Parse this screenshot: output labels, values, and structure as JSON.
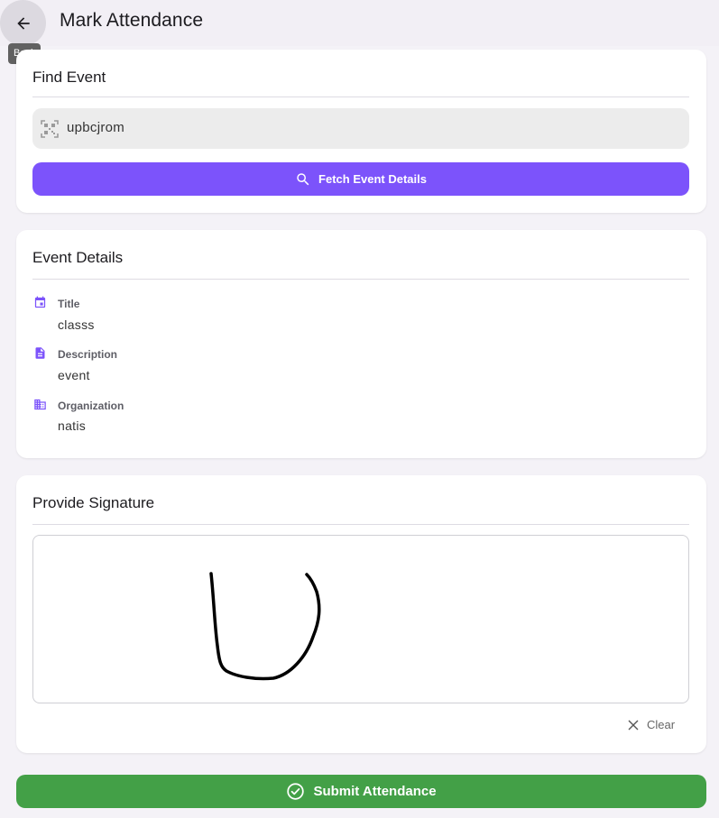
{
  "appbar": {
    "title": "Mark Attendance",
    "back_tooltip": "Back",
    "back_icon": "arrow-back-icon"
  },
  "find_event": {
    "title": "Find Event",
    "code_value": "upbcjrom",
    "code_icon": "qr-code-scanner-icon",
    "fetch_label": "Fetch Event Details",
    "fetch_icon": "search-icon",
    "accent_color": "#7c53fb"
  },
  "event_details": {
    "title": "Event Details",
    "items": [
      {
        "label": "Title",
        "value": "classs",
        "icon": "event-icon"
      },
      {
        "label": "Description",
        "value": "event",
        "icon": "description-icon"
      },
      {
        "label": "Organization",
        "value": "natis",
        "icon": "business-icon"
      }
    ]
  },
  "signature": {
    "title": "Provide Signature",
    "clear_label": "Clear",
    "clear_icon": "close-icon"
  },
  "submit": {
    "label": "Submit Attendance",
    "icon": "check-circle-icon",
    "color": "#43a047"
  }
}
